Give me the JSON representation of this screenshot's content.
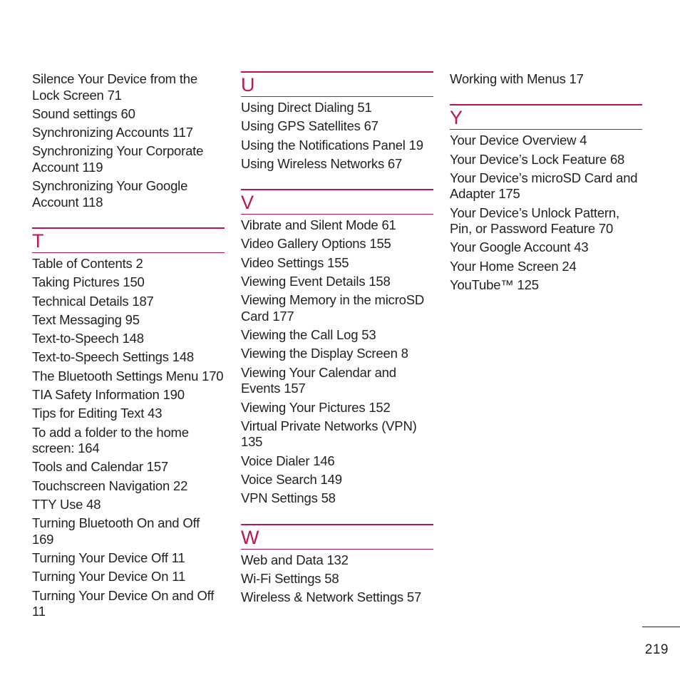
{
  "accent_color": "#c0154b",
  "page_number": "219",
  "columns": [
    {
      "leading_entries": [
        "Silence Your Device from the Lock Screen 71",
        "Sound settings 60",
        "Synchronizing Accounts 117",
        "Synchronizing Your Corporate Account 119",
        "Synchronizing Your Google Account 118"
      ],
      "sections": [
        {
          "letter": "T",
          "entries": [
            "Table of Contents 2",
            "Taking Pictures 150",
            "Technical Details 187",
            "Text Messaging 95",
            "Text-to-Speech 148",
            "Text-to-Speech Settings 148",
            "The Bluetooth Settings Menu 170",
            "TIA Safety Information 190",
            "Tips for Editing Text 43",
            "To add a folder to the home screen: 164",
            "Tools and Calendar 157",
            "Touchscreen Navigation 22",
            "TTY Use 48",
            "Turning Bluetooth On and Off 169",
            "Turning Your Device Off 11",
            "Turning Your Device On 11",
            "Turning Your Device On and Off 11"
          ]
        }
      ]
    },
    {
      "leading_entries": [],
      "sections": [
        {
          "letter": "U",
          "entries": [
            "Using Direct Dialing 51",
            "Using GPS Satellites 67",
            "Using the Notifications Panel 19",
            "Using Wireless Networks 67"
          ]
        },
        {
          "letter": "V",
          "entries": [
            "Vibrate and Silent Mode 61",
            "Video Gallery Options 155",
            "Video Settings 155",
            "Viewing Event Details 158",
            "Viewing Memory in the microSD Card 177",
            "Viewing the Call Log 53",
            "Viewing the Display Screen 8",
            "Viewing Your Calendar and Events 157",
            "Viewing Your Pictures 152",
            "Virtual Private Networks (VPN) 135",
            "Voice Dialer 146",
            "Voice Search 149",
            "VPN Settings 58"
          ]
        },
        {
          "letter": "W",
          "entries": [
            "Web and Data 132",
            "Wi-Fi Settings 58",
            "Wireless & Network Settings 57"
          ]
        }
      ]
    },
    {
      "leading_entries": [
        "Working with Menus 17"
      ],
      "sections": [
        {
          "letter": "Y",
          "entries": [
            "Your Device Overview 4",
            "Your Device’s Lock Feature 68",
            "Your Device’s microSD Card and Adapter 175",
            "Your Device’s Unlock Pattern, Pin, or Password Feature 70",
            "Your Google Account 43",
            "Your Home Screen 24",
            "YouTube™ 125"
          ]
        }
      ]
    }
  ]
}
